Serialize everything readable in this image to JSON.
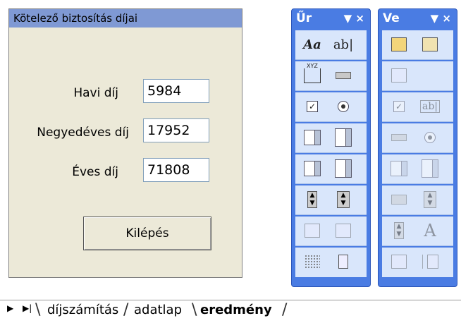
{
  "dialog": {
    "title": "Kötelező biztosítás díjai",
    "fields": [
      {
        "label": "Havi díj",
        "value": "5984"
      },
      {
        "label": "Negyedéves díj",
        "value": "17952"
      },
      {
        "label": "Éves díj",
        "value": "71808"
      }
    ],
    "exit_label": "Kilépés"
  },
  "toolbars": [
    {
      "title": "Űr",
      "controls": "▼ ×"
    },
    {
      "title": "Ve",
      "controls": "▼ ×"
    }
  ],
  "toolbar_icons": {
    "label_text": "Aa",
    "textbox_text": "ab|",
    "frame_text": "XYZ",
    "textbox_dis_text": "ab|",
    "label_A": "A",
    "checkbox_mark": "✓"
  },
  "sheet_tabs": {
    "nav_next": "▶",
    "nav_last": "▶|",
    "tabs": [
      "díjszámítás",
      "adatlap",
      "eredmény"
    ],
    "active_index": 2
  }
}
